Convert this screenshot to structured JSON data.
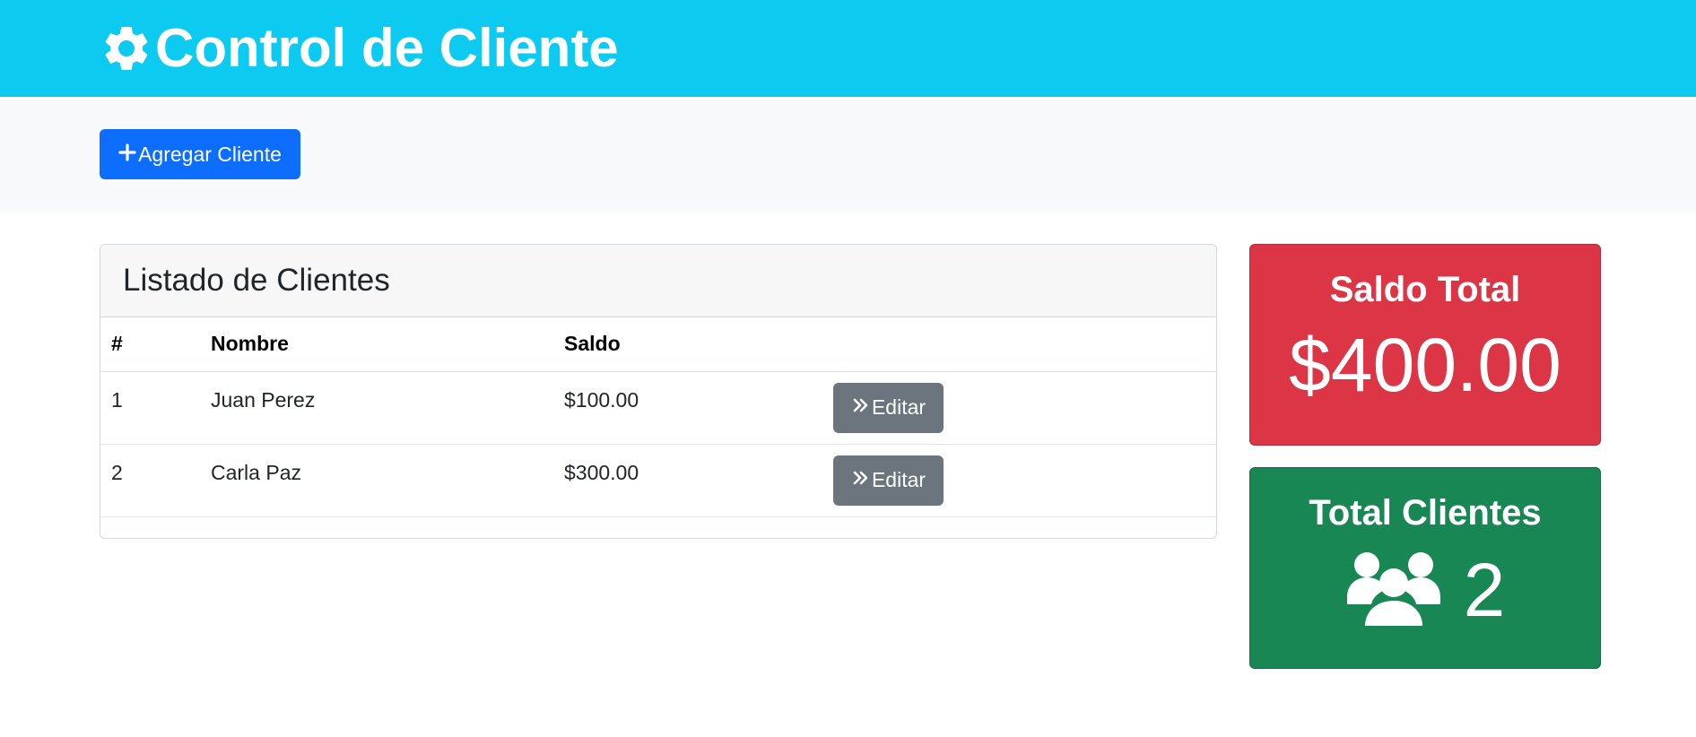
{
  "header": {
    "title": "Control de Cliente",
    "icon": "gear-icon",
    "background": "#0dcaf0"
  },
  "toolbar": {
    "add_label": "Agregar Cliente",
    "add_icon": "plus-icon",
    "add_color": "#0d6efd"
  },
  "clients_card": {
    "title": "Listado de Clientes",
    "columns": [
      "#",
      "Nombre",
      "Saldo",
      ""
    ],
    "rows": [
      {
        "num": "1",
        "name": "Juan Perez",
        "saldo": "$100.00",
        "action": "Editar"
      },
      {
        "num": "2",
        "name": "Carla Paz",
        "saldo": "$300.00",
        "action": "Editar"
      }
    ],
    "edit_icon": "double-chevron-right-icon",
    "edit_color": "#6c757d"
  },
  "stats": {
    "saldo_total": {
      "title": "Saldo Total",
      "value": "$400.00",
      "color": "#dc3545"
    },
    "total_clientes": {
      "title": "Total Clientes",
      "value": "2",
      "icon": "users-icon",
      "color": "#198754"
    }
  }
}
